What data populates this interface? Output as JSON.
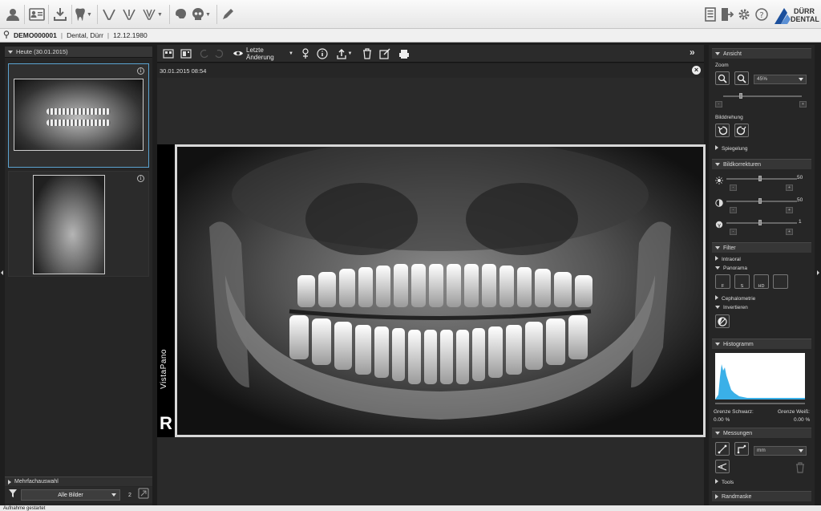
{
  "patient": {
    "id": "DEMO000001",
    "name": "Dental, Dürr",
    "birthdate": "12.12.1980"
  },
  "brand": {
    "line1": "DÜRR",
    "line2": "DENTAL"
  },
  "left_panel": {
    "group_header": "Heute (30.01.2015)",
    "multi_select_label": "Mehrfachauswahl",
    "filter_value": "Alle Bilder",
    "image_count": "2"
  },
  "center": {
    "toolbar": {
      "last_change_label": "Letzte Änderung"
    },
    "image_timestamp": "30.01.2015 08:54",
    "image_label": "VistaPano",
    "side_marker": "R"
  },
  "right_panel": {
    "view": {
      "header": "Ansicht",
      "zoom_label": "Zoom",
      "zoom_value": "45%",
      "rotation_label": "Bilddrehung",
      "mirror_label": "Spiegelung"
    },
    "corrections": {
      "header": "Bildkorrekturen",
      "brightness_value": "50",
      "contrast_value": "50",
      "gamma_value": "1"
    },
    "filter": {
      "header": "Filter",
      "intraoral_label": "Intraoral",
      "panorama_label": "Panorama",
      "panorama_buttons": [
        "F",
        "S",
        "HD",
        ""
      ],
      "cephalometry_label": "Cephalometrie",
      "invert_label": "Invertieren"
    },
    "histogram": {
      "header": "Histogramm",
      "black_limit_label": "Grenze Schwarz:",
      "white_limit_label": "Grenze Weiß:",
      "black_limit_value": "0.00 %",
      "white_limit_value": "0.00 %"
    },
    "measurements": {
      "header": "Messungen",
      "unit_value": "mm",
      "tools_label": "Tools"
    },
    "margin_mask": {
      "header": "Randmaske"
    }
  },
  "status": {
    "text": "Aufnahme gestartet"
  },
  "colors": {
    "accent": "#5ba3d0",
    "histogram": "#3ab0e8",
    "panel_bg": "#262626",
    "toolbar_bg": "#f0f0f0"
  }
}
